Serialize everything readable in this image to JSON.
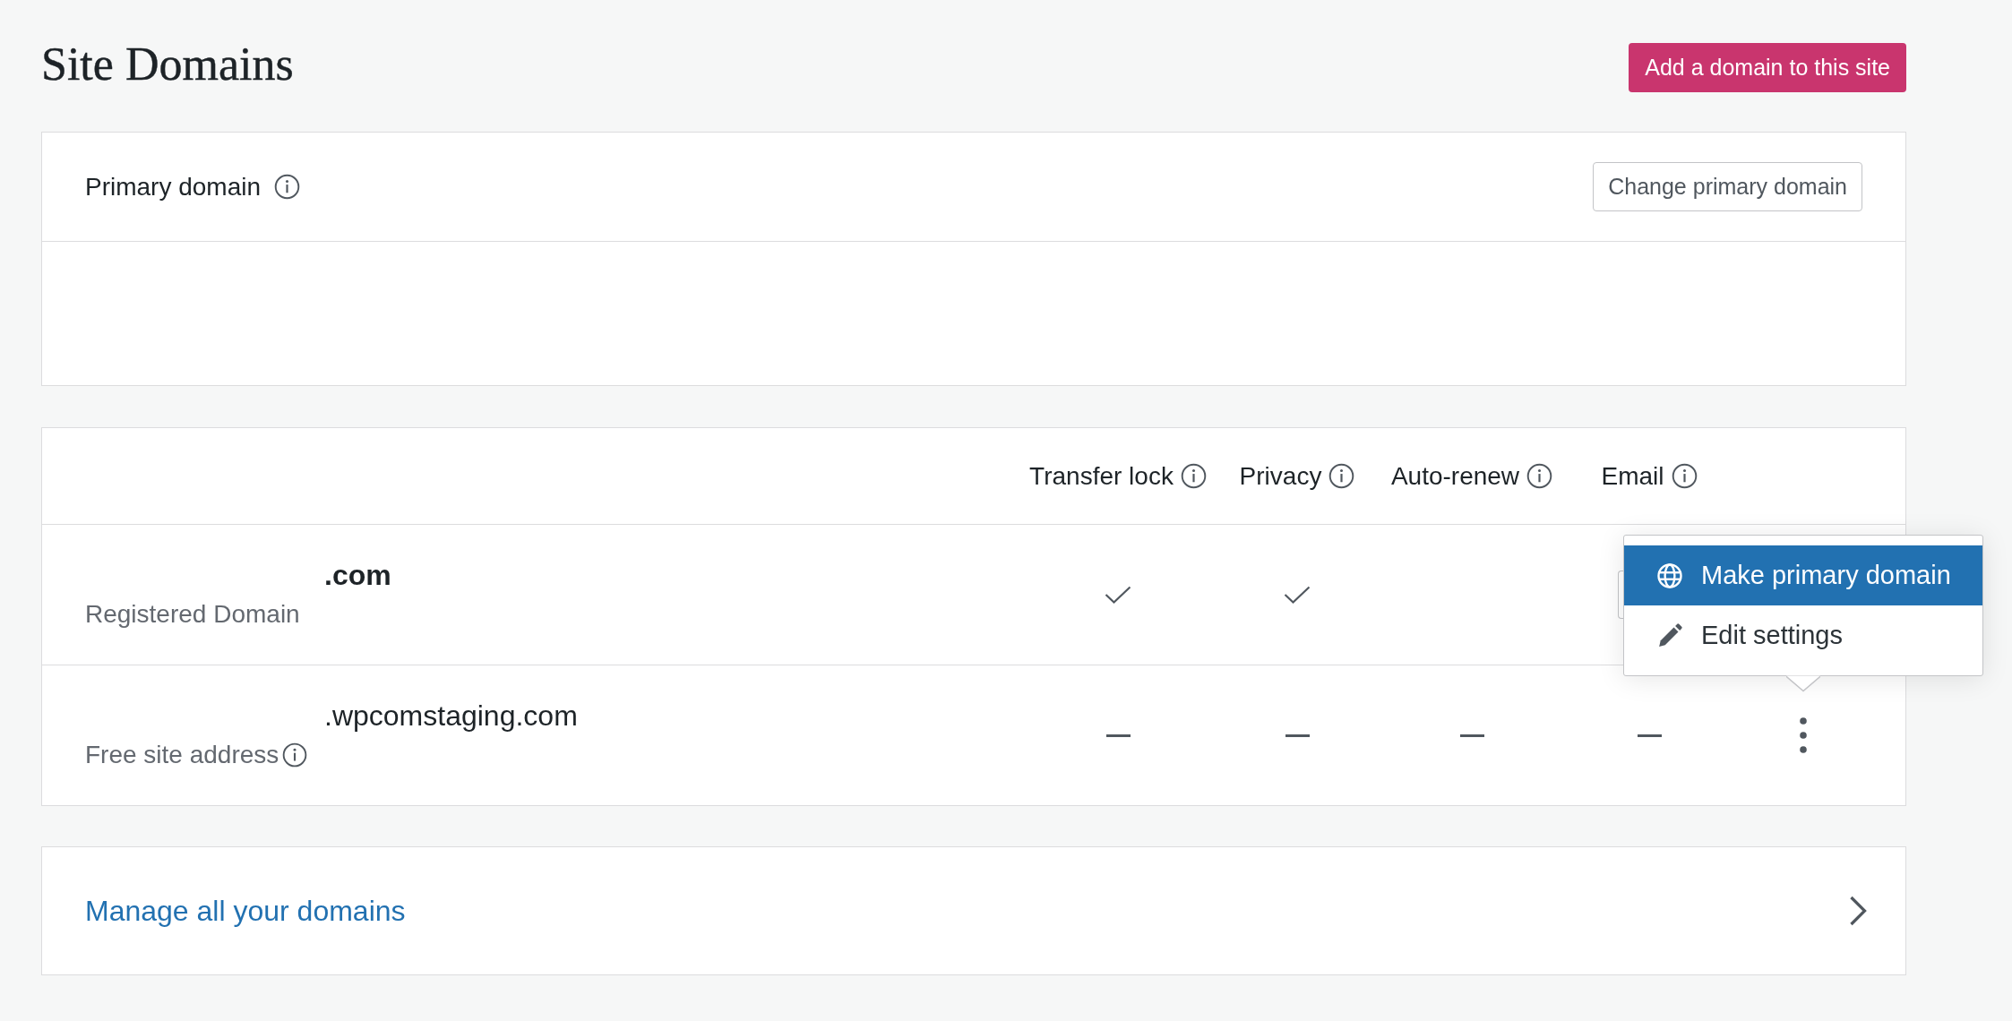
{
  "page": {
    "title": "Site Domains",
    "add_button": "Add a domain to this site"
  },
  "primary_domain": {
    "label": "Primary domain",
    "change_button": "Change primary domain"
  },
  "domains_table": {
    "columns": [
      {
        "label": "Transfer lock"
      },
      {
        "label": "Privacy"
      },
      {
        "label": "Auto-renew"
      },
      {
        "label": "Email"
      }
    ],
    "rows": [
      {
        "name": ".com",
        "emphasized": true,
        "type_label": "Registered Domain",
        "info": false,
        "cells": [
          {
            "kind": "check"
          },
          {
            "kind": "check"
          },
          {
            "kind": "blank"
          },
          {
            "kind": "blank"
          }
        ],
        "more_button": false,
        "covered_button": true
      },
      {
        "name": ".wpcomstaging.com",
        "emphasized": false,
        "type_label": "Free site address",
        "info": true,
        "cells": [
          {
            "kind": "dash"
          },
          {
            "kind": "dash"
          },
          {
            "kind": "dash"
          },
          {
            "kind": "dash"
          }
        ],
        "more_button": true,
        "covered_button": false,
        "menu": {
          "items": [
            {
              "label": "Make primary domain",
              "kind": "primary",
              "selected": true
            },
            {
              "label": "Edit settings",
              "kind": "settings",
              "selected": false
            }
          ]
        }
      }
    ]
  },
  "manage_link": {
    "label": "Manage all your domains"
  }
}
